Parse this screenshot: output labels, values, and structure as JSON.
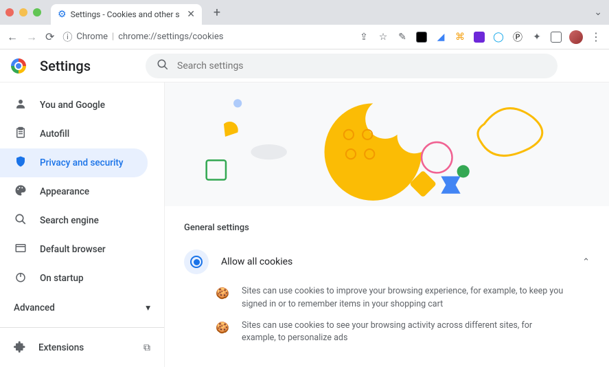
{
  "tab": {
    "title": "Settings - Cookies and other s"
  },
  "url": {
    "scheme": "Chrome",
    "path": "chrome://settings/cookies"
  },
  "header": {
    "title": "Settings"
  },
  "search": {
    "placeholder": "Search settings"
  },
  "sidebar": {
    "items": [
      {
        "icon": "person",
        "label": "You and Google"
      },
      {
        "icon": "autofill",
        "label": "Autofill"
      },
      {
        "icon": "shield",
        "label": "Privacy and security",
        "active": true
      },
      {
        "icon": "palette",
        "label": "Appearance"
      },
      {
        "icon": "search",
        "label": "Search engine"
      },
      {
        "icon": "browser",
        "label": "Default browser"
      },
      {
        "icon": "power",
        "label": "On startup"
      }
    ],
    "advanced": "Advanced",
    "extensions": "Extensions"
  },
  "main": {
    "section_title": "General settings",
    "radio_label": "Allow all cookies",
    "sub1": "Sites can use cookies to improve your browsing experience, for example, to keep you signed in or to remember items in your shopping cart",
    "sub2": "Sites can use cookies to see your browsing activity across different sites, for example, to personalize ads"
  }
}
